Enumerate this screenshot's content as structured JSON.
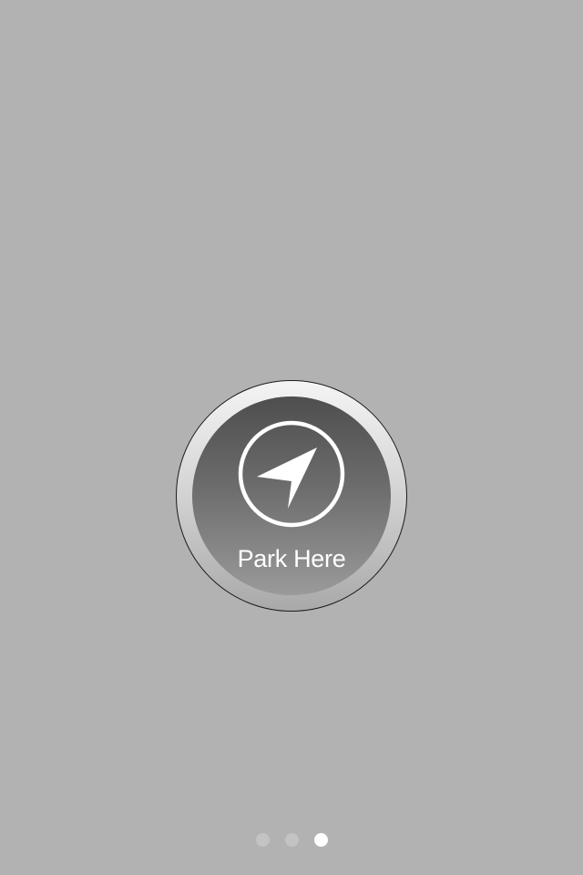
{
  "park_button": {
    "label": "Park Here",
    "icon": "navigation-arrow-icon"
  },
  "page_indicator": {
    "total": 3,
    "current": 3
  },
  "colors": {
    "background": "#b2b2b2",
    "button_face_top": "#4e4e4e",
    "button_face_bottom": "#9a9a9a",
    "dot_inactive": "#c3c3c3",
    "dot_active": "#ffffff"
  }
}
